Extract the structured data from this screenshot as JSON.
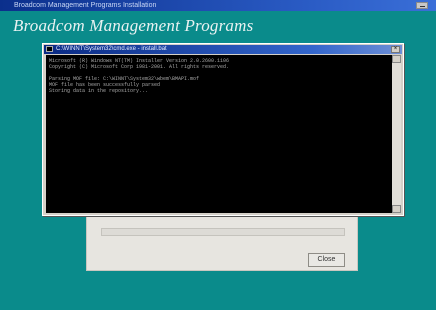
{
  "window": {
    "title": "Broadcom Management Programs Installation"
  },
  "app": {
    "title": "Broadcom Management Programs"
  },
  "console": {
    "title": "C:\\WINNT\\System32\\cmd.exe - install.bat",
    "lines": [
      "Microsoft (R) Windows NT(TM) Installer Version 2.0.2600.1106",
      "Copyright (C) Microsoft Corp 1981-2001. All rights reserved.",
      "",
      "Parsing MOF file: C:\\WINNT\\System32\\wbem\\BMAPI.mof",
      "MOF file has been successfully parsed",
      "Storing data in the repository..."
    ]
  },
  "progress": {
    "value_percent": 0
  },
  "dialog": {
    "close_label": "Close"
  }
}
